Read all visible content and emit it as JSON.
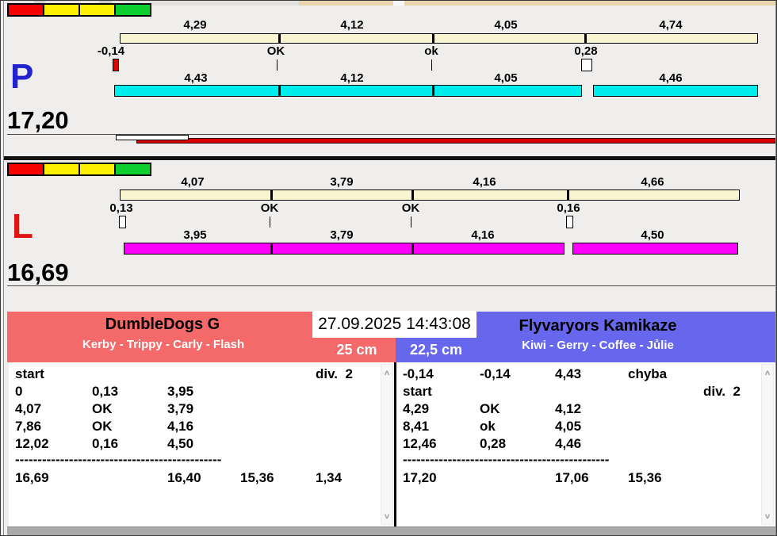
{
  "datetime": "27.09.2025 14:43:08",
  "lane_p": {
    "label": "P",
    "total": "17,20",
    "split_labels": [
      "4,29",
      "4,12",
      "4,05",
      "4,74"
    ],
    "mark_labels": [
      "-0,14",
      "OK",
      "ok",
      "0,28"
    ],
    "segment_labels": [
      "4,43",
      "4,12",
      "4,05",
      "4,46"
    ]
  },
  "lane_l": {
    "label": "L",
    "total": "16,69",
    "split_labels": [
      "4,07",
      "3,79",
      "4,16",
      "4,66"
    ],
    "mark_labels": [
      "0,13",
      "OK",
      "OK",
      "0,16"
    ],
    "segment_labels": [
      "3,95",
      "3,79",
      "4,16",
      "4,50"
    ]
  },
  "team_left": {
    "name": "DumbleDogs G",
    "dogs": "Kerby - Trippy - Carly - Flash",
    "height": "25 cm",
    "rows": [
      [
        "start",
        "",
        "",
        "",
        "div.  2"
      ],
      [
        "0",
        "0,13",
        "3,95",
        "",
        ""
      ],
      [
        "4,07",
        "OK",
        "3,79",
        "",
        ""
      ],
      [
        "7,86",
        "OK",
        "4,16",
        "",
        ""
      ],
      [
        "12,02",
        "0,16",
        "4,50",
        "",
        ""
      ],
      [
        "16,69",
        "",
        "16,40",
        "15,36",
        "1,34"
      ]
    ],
    "separator": "----------------------------------------------"
  },
  "team_right": {
    "name": "Flyvaryors Kamikaze",
    "dogs": "Kiwi - Gerry - Coffee - Jůlie",
    "height": "22,5 cm",
    "rows": [
      [
        "-0,14",
        "-0,14",
        "4,43",
        "chyba",
        ""
      ],
      [
        "start",
        "",
        "",
        "",
        "div.  2"
      ],
      [
        "4,29",
        "OK",
        "4,12",
        "",
        ""
      ],
      [
        "8,41",
        "ok",
        "4,05",
        "",
        ""
      ],
      [
        "12,46",
        "0,28",
        "4,46",
        "",
        ""
      ],
      [
        "17,20",
        "",
        "17,06",
        "15,36",
        ""
      ]
    ],
    "separator": "----------------------------------------------"
  },
  "colors": {
    "lane_p_letter": "#2222cf",
    "lane_l_letter": "#e11414",
    "lane_p_bar": "#00eded",
    "lane_l_bar": "#fa00fa",
    "team_left_bg": "#f4696a",
    "team_right_bg": "#6667ec"
  },
  "scroll": {
    "up": "∧",
    "down": "∨"
  }
}
